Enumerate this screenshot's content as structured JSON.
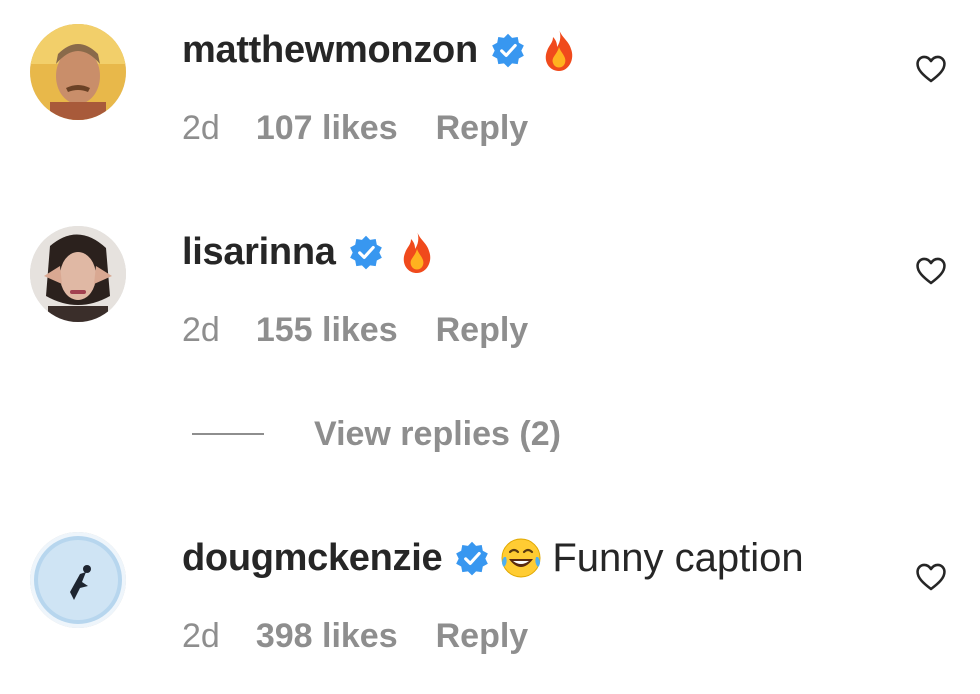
{
  "comments": [
    {
      "username": "matthewmonzon",
      "verified": true,
      "emoji": "fire-icon",
      "text": "",
      "time": "2d",
      "likes": "107 likes",
      "reply_label": "Reply"
    },
    {
      "username": "lisarinna",
      "verified": true,
      "emoji": "fire-icon",
      "text": "",
      "time": "2d",
      "likes": "155 likes",
      "reply_label": "Reply"
    },
    {
      "username": "dougmckenzie",
      "verified": true,
      "emoji": "laughing-tears-icon",
      "text": "Funny caption",
      "time": "2d",
      "likes": "398 likes",
      "reply_label": "Reply"
    }
  ],
  "view_replies": {
    "label": "View replies (2)"
  },
  "colors": {
    "text_primary": "#262626",
    "text_secondary": "#8e8e8e",
    "verified_blue": "#3897f0",
    "background": "#ffffff"
  }
}
